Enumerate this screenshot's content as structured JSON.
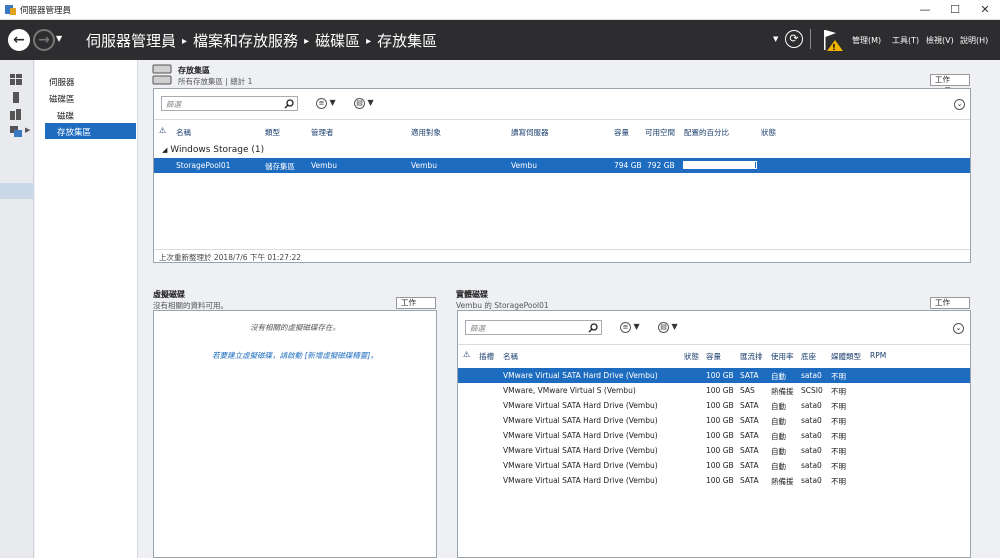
{
  "window": {
    "title": "伺服器管理員",
    "min": "—",
    "max": "☐",
    "close": "✕"
  },
  "header": {
    "breadcrumb": [
      "伺服器管理員",
      "檔案和存放服務",
      "磁碟區",
      "存放集區"
    ],
    "menus": [
      "管理(M)",
      "工具(T)",
      "檢視(V)",
      "說明(H)"
    ]
  },
  "nav": {
    "items": [
      "伺服器",
      "磁碟區",
      "磁碟",
      "存放集區"
    ]
  },
  "pools": {
    "title": "存放集區",
    "subtitle": "所有存放集區 | 總計 1",
    "task": "工作",
    "filter_placeholder": "篩選",
    "columns": [
      "名稱",
      "類型",
      "管理者",
      "適用對象",
      "讀寫伺服器",
      "容量",
      "可用空間",
      "配置的百分比",
      "狀態"
    ],
    "group": "Windows Storage (1)",
    "rows": [
      {
        "name": "StoragePool01",
        "type": "儲存集區",
        "managed_by": "Vembu",
        "applies_to": "Vembu",
        "rw_server": "Vembu",
        "capacity": "794 GB",
        "free": "792 GB",
        "alloc_pct": 0.98
      }
    ],
    "footer": "上次重新整理於 2018/7/6 下午 01:27:22"
  },
  "vdisks": {
    "title": "虛擬磁碟",
    "subtitle": "沒有相關的資料可用。",
    "task": "工作",
    "empty": "沒有相關的虛擬磁碟存在。",
    "hint": "若要建立虛擬磁碟，請啟動 [新增虛擬磁碟精靈]。"
  },
  "pdisks": {
    "title": "實體磁碟",
    "subtitle": "Vembu 的 StoragePool01",
    "task": "工作",
    "filter_placeholder": "篩選",
    "columns": [
      "插槽",
      "名稱",
      "狀態",
      "容量",
      "匯流排",
      "使用率",
      "底座",
      "媒體類型",
      "RPM"
    ],
    "rows": [
      {
        "name": "VMware Virtual SATA Hard Drive (Vembu)",
        "capacity": "100 GB",
        "bus": "SATA",
        "usage": "自動",
        "chassis": "sata0",
        "media": "不明"
      },
      {
        "name": "VMware, VMware Virtual S (Vembu)",
        "capacity": "100 GB",
        "bus": "SAS",
        "usage": "熱備援",
        "chassis": "SCSI0",
        "media": "不明"
      },
      {
        "name": "VMware Virtual SATA Hard Drive (Vembu)",
        "capacity": "100 GB",
        "bus": "SATA",
        "usage": "自動",
        "chassis": "sata0",
        "media": "不明"
      },
      {
        "name": "VMware Virtual SATA Hard Drive (Vembu)",
        "capacity": "100 GB",
        "bus": "SATA",
        "usage": "自動",
        "chassis": "sata0",
        "media": "不明"
      },
      {
        "name": "VMware Virtual SATA Hard Drive (Vembu)",
        "capacity": "100 GB",
        "bus": "SATA",
        "usage": "自動",
        "chassis": "sata0",
        "media": "不明"
      },
      {
        "name": "VMware Virtual SATA Hard Drive (Vembu)",
        "capacity": "100 GB",
        "bus": "SATA",
        "usage": "自動",
        "chassis": "sata0",
        "media": "不明"
      },
      {
        "name": "VMware Virtual SATA Hard Drive (Vembu)",
        "capacity": "100 GB",
        "bus": "SATA",
        "usage": "自動",
        "chassis": "sata0",
        "media": "不明"
      },
      {
        "name": "VMware Virtual SATA Hard Drive (Vembu)",
        "capacity": "100 GB",
        "bus": "SATA",
        "usage": "熱備援",
        "chassis": "sata0",
        "media": "不明"
      }
    ]
  }
}
